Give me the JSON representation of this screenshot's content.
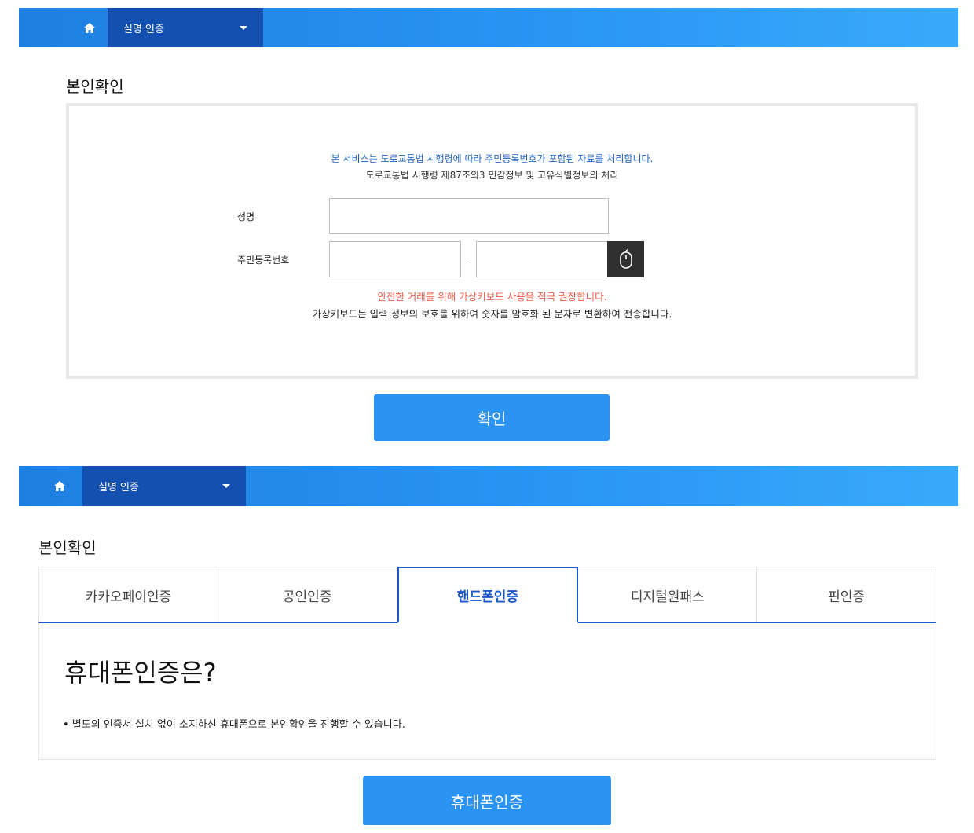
{
  "top": {
    "nav": {
      "menu_label": "실명 인증"
    },
    "title": "본인확인",
    "notice_blue": "본 서비스는 도로교통법 시행령에 따라 주민등록번호가 포함된 자료를 처리합니다.",
    "notice_gray": "도로교통법 시행령 제87조의3 민감정보 및 고유식별정보의 처리",
    "name_label": "성명",
    "name_value": "",
    "rrn_label": "주민등록번호",
    "rrn_front_value": "",
    "rrn_back_value": "",
    "rrn_dash": "-",
    "virtual_keyboard_icon": "mouse-icon",
    "warning_red": "안전한 거래를 위해 가상키보드 사용을 적극 권장합니다.",
    "warning_gray": "가상키보드는 입력 정보의 보호를 위하여 숫자를 암호화 된 문자로 변환하여 전송합니다.",
    "confirm_label": "확인"
  },
  "bottom": {
    "nav": {
      "menu_label": "실명 인증"
    },
    "title": "본인확인",
    "tabs": [
      {
        "label": "카카오페이인증",
        "active": false
      },
      {
        "label": "공인인증",
        "active": false
      },
      {
        "label": "핸드폰인증",
        "active": true
      },
      {
        "label": "디지털원패스",
        "active": false
      },
      {
        "label": "핀인증",
        "active": false
      }
    ],
    "panel_heading": "휴대폰인증은?",
    "panel_text": "• 별도의 인증서 설치 없이 소지하신 휴대폰으로 본인확인을 진행할 수 있습니다.",
    "phone_auth_label": "휴대폰인증"
  },
  "colors": {
    "accent": "#2b94f3",
    "menu": "#1350b0",
    "tab_active": "#1b58c9",
    "warning": "#ef5a4a"
  }
}
